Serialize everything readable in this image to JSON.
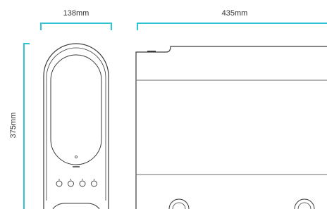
{
  "colors": {
    "dimension_line": "#2ec4d6",
    "outline": "#3a3a3a",
    "text": "#333333"
  },
  "dimensions": {
    "width_label": "138mm",
    "depth_label": "435mm",
    "height_label": "375mm"
  },
  "front_view": {
    "button_count": 4
  }
}
